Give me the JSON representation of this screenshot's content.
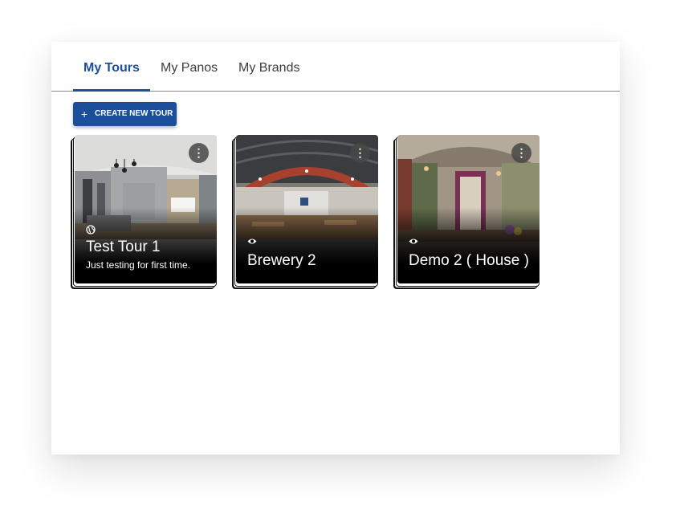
{
  "tabs": [
    {
      "label": "My Tours",
      "active": true
    },
    {
      "label": "My Panos",
      "active": false
    },
    {
      "label": "My Brands",
      "active": false
    }
  ],
  "create_button": {
    "label": "CREATE NEW TOUR",
    "icon": "plus-icon"
  },
  "tours": [
    {
      "title": "Test Tour 1",
      "description": "Just testing for first time.",
      "visibility_icon": "globe-icon",
      "menu_icon": "more-vertical-icon"
    },
    {
      "title": "Brewery 2",
      "description": "",
      "visibility_icon": "eye-icon",
      "menu_icon": "more-vertical-icon"
    },
    {
      "title": "Demo 2 ( House )",
      "description": "",
      "visibility_icon": "eye-icon",
      "menu_icon": "more-vertical-icon"
    }
  ],
  "colors": {
    "accent": "#1b4f9c",
    "tab_inactive": "#3d3d3d"
  }
}
